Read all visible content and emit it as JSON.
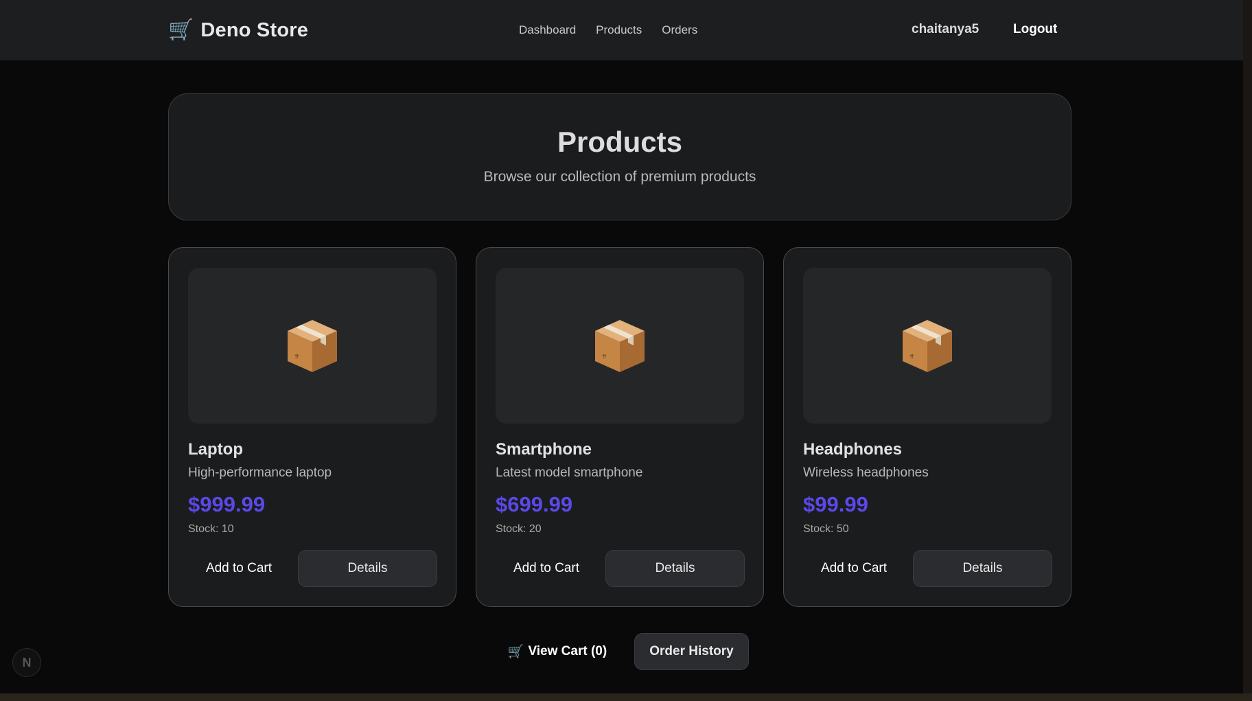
{
  "navbar": {
    "brand_icon": "🛒",
    "brand": "Deno Store",
    "links": [
      "Dashboard",
      "Products",
      "Orders"
    ],
    "username": "chaitanya5",
    "logout": "Logout"
  },
  "hero": {
    "title": "Products",
    "subtitle": "Browse our collection of premium products"
  },
  "products": [
    {
      "name": "Laptop",
      "description": "High-performance laptop",
      "price": "$999.99",
      "stock": "Stock: 10",
      "image_icon": "package-icon"
    },
    {
      "name": "Smartphone",
      "description": "Latest model smartphone",
      "price": "$699.99",
      "stock": "Stock: 20",
      "image_icon": "package-icon"
    },
    {
      "name": "Headphones",
      "description": "Wireless headphones",
      "price": "$99.99",
      "stock": "Stock: 50",
      "image_icon": "package-icon"
    }
  ],
  "card_actions": {
    "add_to_cart": "Add to Cart",
    "details": "Details"
  },
  "footer_actions": {
    "cart_icon": "🛒",
    "view_cart": "View Cart (0)",
    "order_history": "Order History"
  },
  "dev_badge": {
    "icon": "next-logo-icon",
    "letter": "N"
  },
  "colors": {
    "background": "#090909",
    "surface": "#1b1c1e",
    "navbar": "#1d1e20",
    "price_accent": "#5b48e8",
    "button_secondary": "#2a2c2f"
  }
}
